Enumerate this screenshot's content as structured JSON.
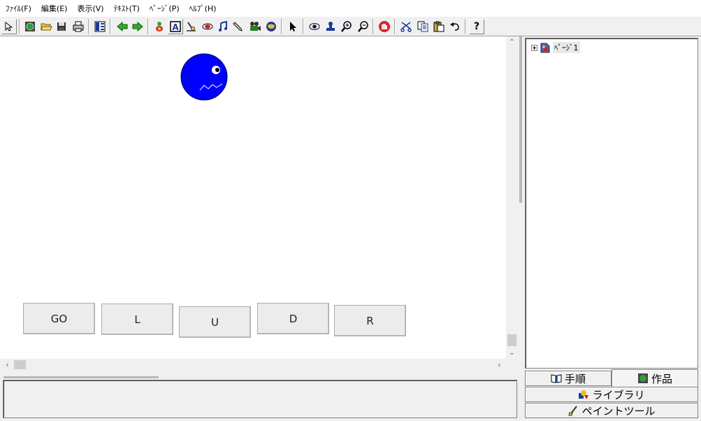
{
  "menu": {
    "file": "ﾌｧｲﾙ(F)",
    "edit": "編集(E)",
    "view": "表示(V)",
    "text": "ﾃｷｽﾄ(T)",
    "page": "ﾍﾟｰｼﾞ(P)",
    "help": "ﾍﾙﾌﾟ(H)"
  },
  "toolbar": {
    "icons": [
      "select-arrow-icon",
      "new-world-icon",
      "open-folder-icon",
      "save-disk-icon",
      "print-icon",
      "layout-panel-icon",
      "back-arrow-icon",
      "forward-arrow-icon",
      "character-icon",
      "text-box-icon",
      "magnet-icon",
      "eraser-icon",
      "music-note-icon",
      "pen-icon",
      "movie-camera-icon",
      "globe-icon",
      "pointer-icon",
      "eye-icon",
      "stamp-icon",
      "zoom-in-icon",
      "zoom-out-icon",
      "stop-hand-icon",
      "scissors-icon",
      "copy-icon",
      "paste-icon",
      "undo-icon",
      "help-icon"
    ],
    "help_label": "?",
    "text_label": "A"
  },
  "stage": {
    "buttons": [
      "GO",
      "L",
      "U",
      "D",
      "R"
    ],
    "character_color": "#0000ff"
  },
  "tree": {
    "root_label": "ﾍﾟｰｼﾞ1"
  },
  "tabs": {
    "procedure": "手順",
    "works": "作品",
    "library": "ライブラリ",
    "paint": "ペイントツール"
  }
}
